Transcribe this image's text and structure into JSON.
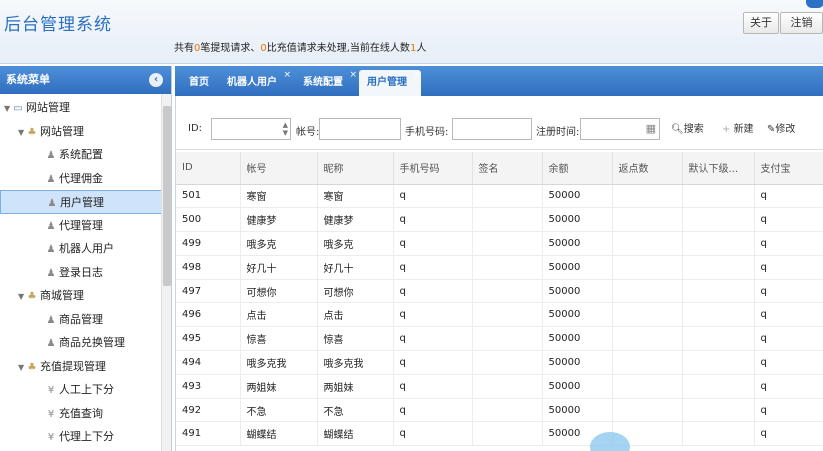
{
  "header": {
    "title": "后台管理系统",
    "notice_prefix": "共有",
    "withdraw_count": "0",
    "notice_mid1": "笔提现请求、",
    "recharge_count": "0",
    "notice_mid2": "比充值请求未处理,当前在线人数",
    "online_count": "1",
    "notice_suffix": "人",
    "about_label": "关于",
    "logout_label": "注销"
  },
  "sidebar": {
    "title": "系统菜单",
    "collapse_icon": "chevron-left-icon",
    "items": [
      {
        "label": "网站管理",
        "level": 0,
        "icon": "monitor-icon"
      },
      {
        "label": "网站管理",
        "level": 1,
        "icon": "users-icon"
      },
      {
        "label": "系统配置",
        "level": 2,
        "icon": "user-icon"
      },
      {
        "label": "代理佣金",
        "level": 2,
        "icon": "user-icon"
      },
      {
        "label": "用户管理",
        "level": 2,
        "icon": "user-icon",
        "selected": true
      },
      {
        "label": "代理管理",
        "level": 2,
        "icon": "user-icon"
      },
      {
        "label": "机器人用户",
        "level": 2,
        "icon": "user-icon"
      },
      {
        "label": "登录日志",
        "level": 2,
        "icon": "user-icon"
      },
      {
        "label": "商城管理",
        "level": 1,
        "icon": "users-icon"
      },
      {
        "label": "商品管理",
        "level": 2,
        "icon": "user-icon"
      },
      {
        "label": "商品兑换管理",
        "level": 2,
        "icon": "user-icon"
      },
      {
        "label": "充值提现管理",
        "level": 1,
        "icon": "users-icon"
      },
      {
        "label": "人工上下分",
        "level": 2,
        "icon": "coins-icon"
      },
      {
        "label": "充值查询",
        "level": 2,
        "icon": "coins-icon"
      },
      {
        "label": "代理上下分",
        "level": 2,
        "icon": "coins-icon"
      }
    ]
  },
  "tabs": [
    {
      "label": "首页",
      "closable": false
    },
    {
      "label": "机器人用户",
      "closable": true
    },
    {
      "label": "系统配置",
      "closable": true
    },
    {
      "label": "用户管理",
      "closable": true,
      "active": true
    }
  ],
  "toolbar": {
    "id_label": "ID:",
    "account_label": "帐号:",
    "phone_label": "手机号码:",
    "regtime_label": "注册时间:",
    "search_label": "搜索",
    "new_label": "新建",
    "edit_label": "修改"
  },
  "table": {
    "columns": [
      "ID",
      "帐号",
      "昵称",
      "手机号码",
      "签名",
      "余额",
      "返点数",
      "默认下级...",
      "支付宝"
    ],
    "rows": [
      {
        "id": "501",
        "account": "寒窗",
        "nickname": "寒窗",
        "phone": "q",
        "sign": "",
        "balance": "50000",
        "rebate": "",
        "default": "",
        "alipay": "q"
      },
      {
        "id": "500",
        "account": "健康梦",
        "nickname": "健康梦",
        "phone": "q",
        "sign": "",
        "balance": "50000",
        "rebate": "",
        "default": "",
        "alipay": "q"
      },
      {
        "id": "499",
        "account": "哦多克",
        "nickname": "哦多克",
        "phone": "q",
        "sign": "",
        "balance": "50000",
        "rebate": "",
        "default": "",
        "alipay": "q"
      },
      {
        "id": "498",
        "account": "好几十",
        "nickname": "好几十",
        "phone": "q",
        "sign": "",
        "balance": "50000",
        "rebate": "",
        "default": "",
        "alipay": "q"
      },
      {
        "id": "497",
        "account": "可想你",
        "nickname": "可想你",
        "phone": "q",
        "sign": "",
        "balance": "50000",
        "rebate": "",
        "default": "",
        "alipay": "q"
      },
      {
        "id": "496",
        "account": "点击",
        "nickname": "点击",
        "phone": "q",
        "sign": "",
        "balance": "50000",
        "rebate": "",
        "default": "",
        "alipay": "q"
      },
      {
        "id": "495",
        "account": "惊喜",
        "nickname": "惊喜",
        "phone": "q",
        "sign": "",
        "balance": "50000",
        "rebate": "",
        "default": "",
        "alipay": "q"
      },
      {
        "id": "494",
        "account": "哦多克我",
        "nickname": "哦多克我",
        "phone": "q",
        "sign": "",
        "balance": "50000",
        "rebate": "",
        "default": "",
        "alipay": "q"
      },
      {
        "id": "493",
        "account": "两姐妹",
        "nickname": "两姐妹",
        "phone": "q",
        "sign": "",
        "balance": "50000",
        "rebate": "",
        "default": "",
        "alipay": "q"
      },
      {
        "id": "492",
        "account": "不急",
        "nickname": "不急",
        "phone": "q",
        "sign": "",
        "balance": "50000",
        "rebate": "",
        "default": "",
        "alipay": "q"
      },
      {
        "id": "491",
        "account": "蝴蝶结",
        "nickname": "蝴蝶结",
        "phone": "q",
        "sign": "",
        "balance": "50000",
        "rebate": "",
        "default": "",
        "alipay": "q"
      }
    ]
  },
  "colors": {
    "brand_blue": "#2f6fbf",
    "title_blue": "#2a6fc2",
    "highlight_orange": "#e07800",
    "selected_bg": "#cfe3fa"
  }
}
